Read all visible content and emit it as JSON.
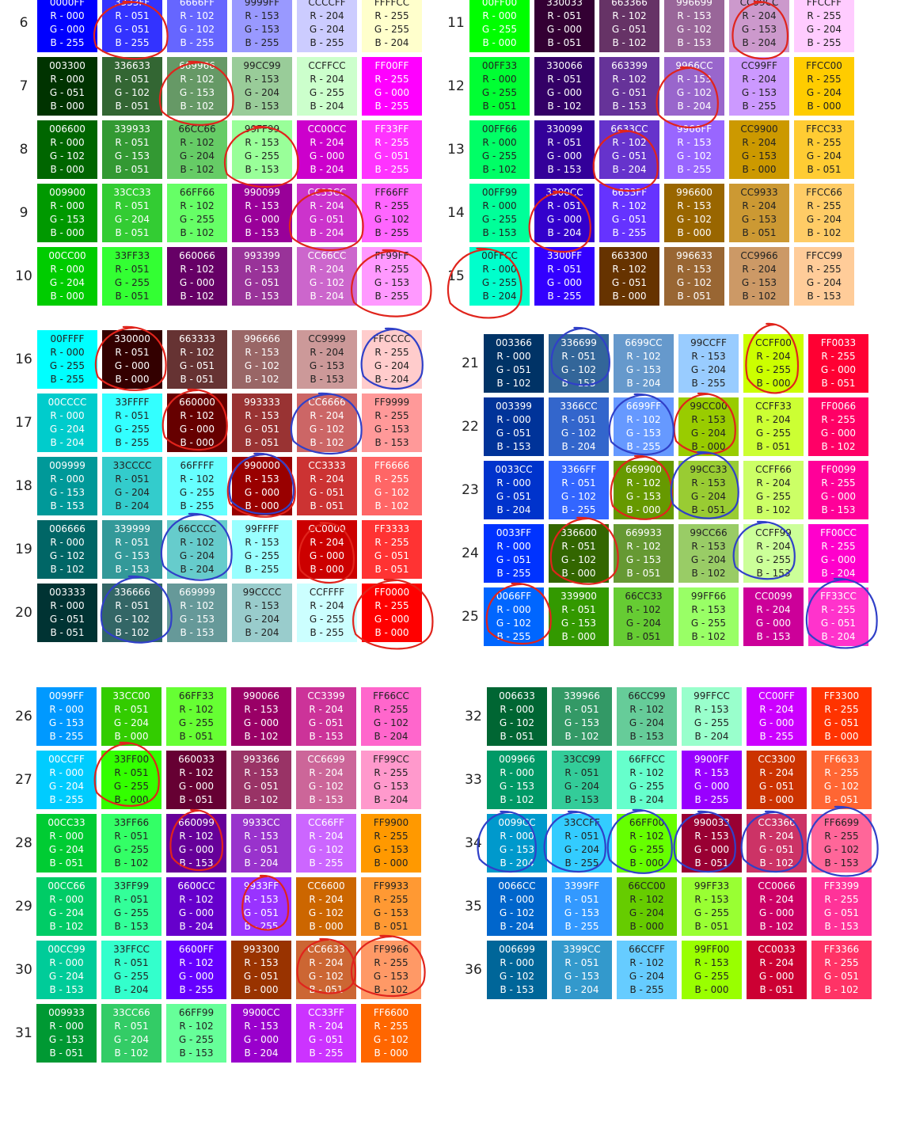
{
  "groups": [
    {
      "name": "group-6-15-left",
      "rows": [
        {
          "num": "6",
          "cells": [
            "0000FF",
            "3333FF",
            "6666FF",
            "9999FF",
            "CCCCFF",
            "FFFFCC"
          ]
        },
        {
          "num": "7",
          "cells": [
            "003300",
            "336633",
            "669966",
            "99CC99",
            "CCFFCC",
            "FF00FF"
          ]
        },
        {
          "num": "8",
          "cells": [
            "006600",
            "339933",
            "66CC66",
            "99FF99",
            "CC00CC",
            "FF33FF"
          ]
        },
        {
          "num": "9",
          "cells": [
            "009900",
            "33CC33",
            "66FF66",
            "990099",
            "CC33CC",
            "FF66FF"
          ]
        },
        {
          "num": "10",
          "cells": [
            "00CC00",
            "33FF33",
            "660066",
            "993399",
            "CC66CC",
            "FF99FF"
          ]
        }
      ]
    },
    {
      "name": "group-11-15-right",
      "rows": [
        {
          "num": "11",
          "cells": [
            "00FF00",
            "330033",
            "663366",
            "996699",
            "CC99CC",
            "FFCCFF"
          ]
        },
        {
          "num": "12",
          "cells": [
            "00FF33",
            "330066",
            "663399",
            "9966CC",
            "CC99FF",
            "FFCC00"
          ]
        },
        {
          "num": "13",
          "cells": [
            "00FF66",
            "330099",
            "6633CC",
            "9966FF",
            "CC9900",
            "FFCC33"
          ]
        },
        {
          "num": "14",
          "cells": [
            "00FF99",
            "3300CC",
            "6633FF",
            "996600",
            "CC9933",
            "FFCC66"
          ]
        },
        {
          "num": "15",
          "cells": [
            "00FFCC",
            "3300FF",
            "663300",
            "996633",
            "CC9966",
            "FFCC99"
          ]
        }
      ]
    },
    {
      "name": "group-16-20-left",
      "rows": [
        {
          "num": "16",
          "cells": [
            "00FFFF",
            "330000",
            "663333",
            "996666",
            "CC9999",
            "FFCCCC"
          ]
        },
        {
          "num": "17",
          "cells": [
            "00CCCC",
            "33FFFF",
            "660000",
            "993333",
            "CC6666",
            "FF9999"
          ]
        },
        {
          "num": "18",
          "cells": [
            "009999",
            "33CCCC",
            "66FFFF",
            "990000",
            "CC3333",
            "FF6666"
          ]
        },
        {
          "num": "19",
          "cells": [
            "006666",
            "339999",
            "66CCCC",
            "99FFFF",
            "CC0000",
            "FF3333"
          ]
        },
        {
          "num": "20",
          "cells": [
            "003333",
            "336666",
            "669999",
            "99CCCC",
            "CCFFFF",
            "FF0000"
          ]
        }
      ]
    },
    {
      "name": "group-21-25-right",
      "rows": [
        {
          "num": "21",
          "cells": [
            "003366",
            "336699",
            "6699CC",
            "99CCFF",
            "CCFF00",
            "FF0033"
          ]
        },
        {
          "num": "22",
          "cells": [
            "003399",
            "3366CC",
            "6699FF",
            "99CC00",
            "CCFF33",
            "FF0066"
          ]
        },
        {
          "num": "23",
          "cells": [
            "0033CC",
            "3366FF",
            "669900",
            "99CC33",
            "CCFF66",
            "FF0099"
          ]
        },
        {
          "num": "24",
          "cells": [
            "0033FF",
            "336600",
            "669933",
            "99CC66",
            "CCFF99",
            "FF00CC"
          ]
        },
        {
          "num": "25",
          "cells": [
            "0066FF",
            "339900",
            "66CC33",
            "99FF66",
            "CC0099",
            "FF33CC"
          ]
        }
      ]
    },
    {
      "name": "group-26-31-left",
      "rows": [
        {
          "num": "26",
          "cells": [
            "0099FF",
            "33CC00",
            "66FF33",
            "990066",
            "CC3399",
            "FF66CC"
          ]
        },
        {
          "num": "27",
          "cells": [
            "00CCFF",
            "33FF00",
            "660033",
            "993366",
            "CC6699",
            "FF99CC"
          ]
        },
        {
          "num": "28",
          "cells": [
            "00CC33",
            "33FF66",
            "660099",
            "9933CC",
            "CC66FF",
            "FF9900"
          ]
        },
        {
          "num": "29",
          "cells": [
            "00CC66",
            "33FF99",
            "6600CC",
            "9933FF",
            "CC6600",
            "FF9933"
          ]
        },
        {
          "num": "30",
          "cells": [
            "00CC99",
            "33FFCC",
            "6600FF",
            "993300",
            "CC6633",
            "FF9966"
          ]
        },
        {
          "num": "31",
          "cells": [
            "009933",
            "33CC66",
            "66FF99",
            "9900CC",
            "CC33FF",
            "FF6600"
          ]
        }
      ]
    },
    {
      "name": "group-32-36-right",
      "rows": [
        {
          "num": "32",
          "cells": [
            "006633",
            "339966",
            "66CC99",
            "99FFCC",
            "CC00FF",
            "FF3300"
          ]
        },
        {
          "num": "33",
          "cells": [
            "009966",
            "33CC99",
            "66FFCC",
            "9900FF",
            "CC3300",
            "FF6633"
          ]
        },
        {
          "num": "34",
          "cells": [
            "0099CC",
            "33CCFF",
            "66FF00",
            "990033",
            "CC3366",
            "FF6699"
          ]
        },
        {
          "num": "35",
          "cells": [
            "0066CC",
            "3399FF",
            "66CC00",
            "99FF33",
            "CC0066",
            "FF3399"
          ]
        },
        {
          "num": "36",
          "cells": [
            "006699",
            "3399CC",
            "66CCFF",
            "99FF00",
            "CC0033",
            "FF3366"
          ]
        }
      ]
    }
  ],
  "annotation_colors": {
    "red": "#e0241c",
    "blue": "#3040c8"
  }
}
